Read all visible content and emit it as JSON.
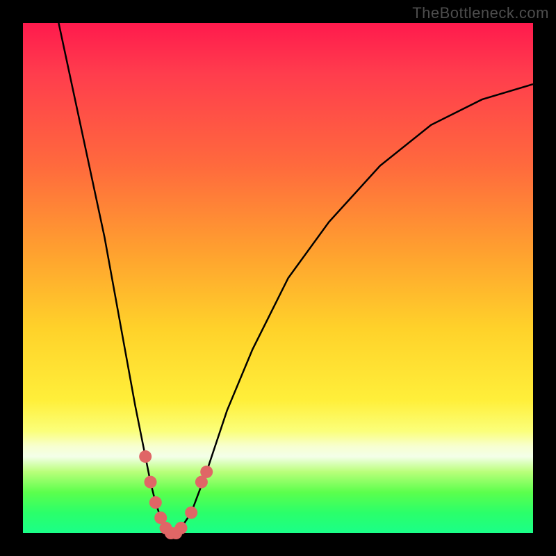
{
  "watermark": "TheBottleneck.com",
  "chart_data": {
    "type": "line",
    "title": "",
    "xlabel": "",
    "ylabel": "",
    "xlim": [
      0,
      100
    ],
    "ylim": [
      0,
      100
    ],
    "grid": false,
    "series": [
      {
        "name": "bottleneck-curve",
        "x": [
          7,
          10,
          13,
          16,
          18,
          20,
          22,
          24,
          25,
          26,
          27,
          28,
          29,
          30,
          31,
          33,
          36,
          40,
          45,
          52,
          60,
          70,
          80,
          90,
          100
        ],
        "values": [
          100,
          86,
          72,
          58,
          47,
          36,
          25,
          15,
          10,
          6,
          3,
          1,
          0,
          0,
          1,
          4,
          12,
          24,
          36,
          50,
          61,
          72,
          80,
          85,
          88
        ]
      }
    ],
    "markers": [
      {
        "name": "marker-left-1",
        "x": 24,
        "y": 15
      },
      {
        "name": "marker-left-2",
        "x": 25,
        "y": 10
      },
      {
        "name": "marker-left-3",
        "x": 26,
        "y": 6
      },
      {
        "name": "marker-bottom-1",
        "x": 27,
        "y": 3
      },
      {
        "name": "marker-bottom-2",
        "x": 28,
        "y": 1
      },
      {
        "name": "marker-bottom-3",
        "x": 29,
        "y": 0
      },
      {
        "name": "marker-bottom-4",
        "x": 30,
        "y": 0
      },
      {
        "name": "marker-bottom-5",
        "x": 31,
        "y": 1
      },
      {
        "name": "marker-right-1",
        "x": 33,
        "y": 4
      },
      {
        "name": "marker-right-2",
        "x": 35,
        "y": 10
      },
      {
        "name": "marker-right-3",
        "x": 36,
        "y": 12
      }
    ],
    "colors": {
      "curve": "#000000",
      "marker": "#e06666",
      "bg_top": "#ff1a4d",
      "bg_mid": "#ffd22a",
      "bg_bot": "#1aff88"
    }
  }
}
